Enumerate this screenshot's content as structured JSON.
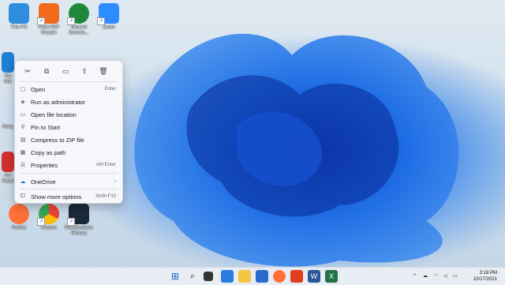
{
  "desktop_icons": [
    {
      "label": "This PC",
      "icon": "monitor-icon",
      "color": "#2f8de0"
    },
    {
      "label": "Foxit PDF Reader",
      "icon": "foxit-icon",
      "color": "#f26b1d"
    },
    {
      "label": "Internet Downlo...",
      "icon": "idm-icon",
      "color": "#1c8a3a"
    },
    {
      "label": "Zoom",
      "icon": "zoom-icon",
      "color": "#2d8cff"
    },
    {
      "label": "Firefox",
      "icon": "firefox-icon",
      "color": "#ff7139"
    },
    {
      "label": "chrome",
      "icon": "chrome-icon",
      "color": "#34a853"
    },
    {
      "label": "Wondershare Filmora",
      "icon": "filmora-icon",
      "color": "#1b2a3a"
    }
  ],
  "partial_labels": [
    "Fla",
    "Wiz",
    "Recy",
    "Acr",
    "Read"
  ],
  "context_menu": {
    "quick_actions": [
      "cut-icon",
      "copy-icon",
      "rename-icon",
      "share-icon",
      "delete-icon"
    ],
    "items": [
      {
        "label": "Open",
        "shortcut": "Enter",
        "icon": "open-icon"
      },
      {
        "label": "Run as administrator",
        "shortcut": "",
        "icon": "shield-icon"
      },
      {
        "label": "Open file location",
        "shortcut": "",
        "icon": "folder-icon"
      },
      {
        "label": "Pin to Start",
        "shortcut": "",
        "icon": "pin-icon"
      },
      {
        "label": "Compress to ZIP file",
        "shortcut": "",
        "icon": "zip-icon"
      },
      {
        "label": "Copy as path",
        "shortcut": "",
        "icon": "path-icon"
      },
      {
        "label": "Properties",
        "shortcut": "Alt+Enter",
        "icon": "properties-icon"
      },
      {
        "label": "OneDrive",
        "shortcut": "›",
        "icon": "onedrive-icon"
      },
      {
        "label": "Show more options",
        "shortcut": "Shift+F10",
        "icon": "more-options-icon"
      }
    ]
  },
  "taskbar": {
    "time": "3:18 PM",
    "date": "10/17/2021",
    "tray_caret": "^"
  }
}
